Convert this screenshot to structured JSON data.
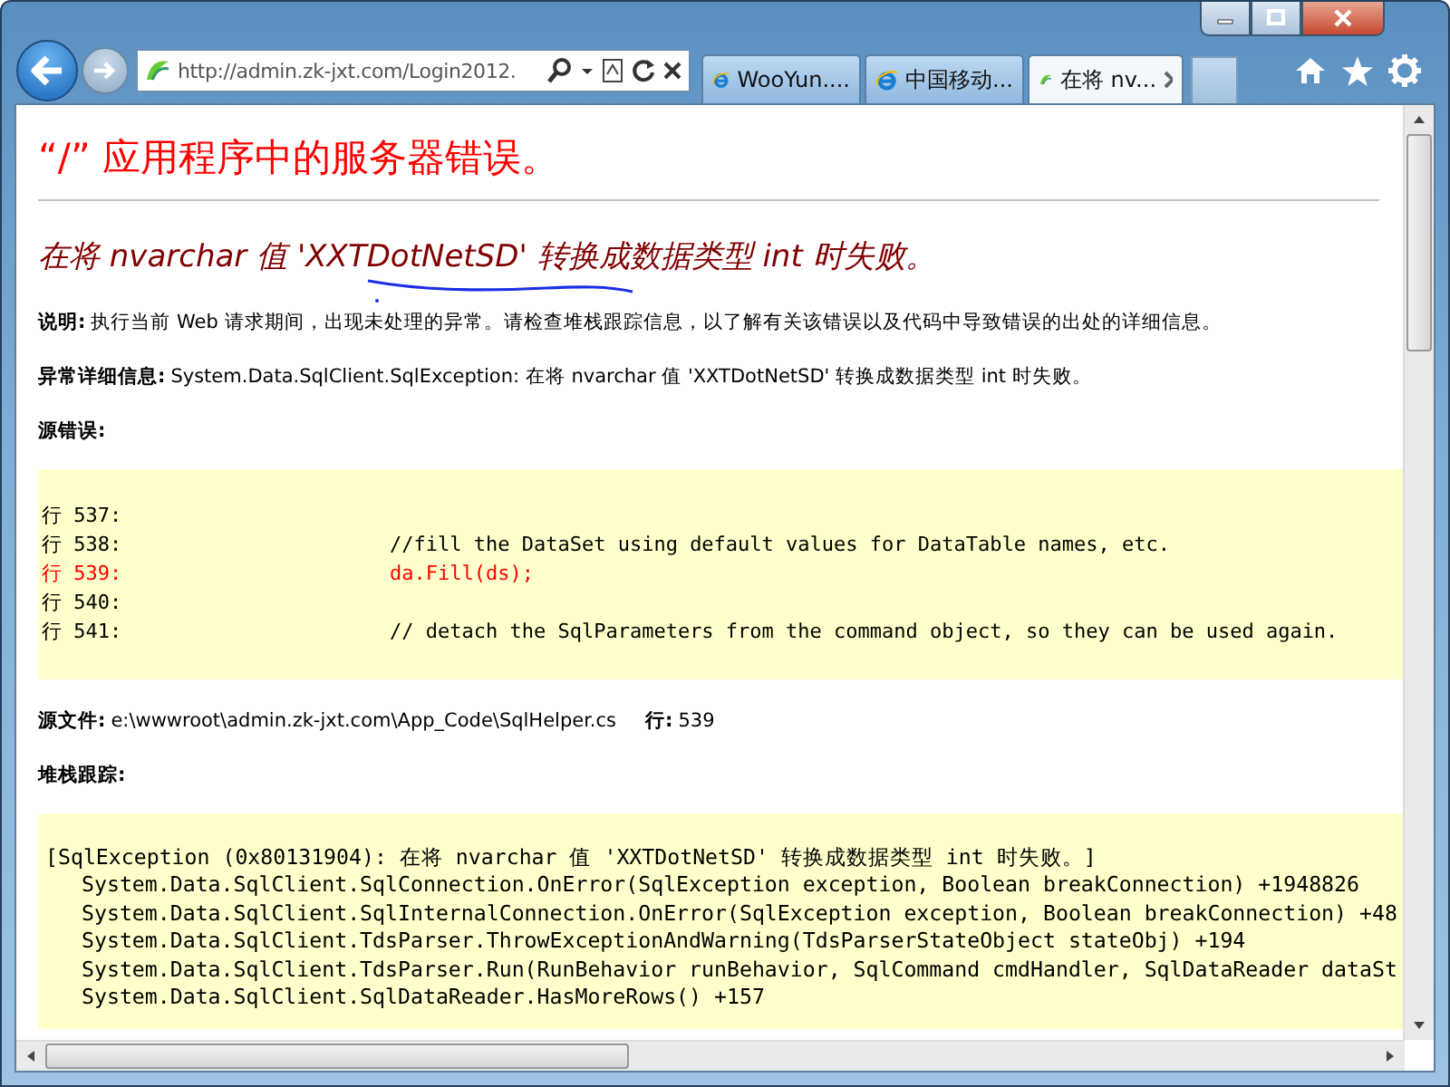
{
  "address_bar": {
    "url": "http://admin.zk-jxt.com/Login2012."
  },
  "tabs": [
    {
      "label": "WooYun....",
      "selected": false,
      "kind": "ie"
    },
    {
      "label": "中国移动...",
      "selected": false,
      "kind": "ie"
    },
    {
      "label": "在将 nv...",
      "selected": true,
      "kind": "site"
    }
  ],
  "page": {
    "title": "“/” 应用程序中的服务器错误。",
    "error_heading": {
      "before": "在将 nvarchar 值 ",
      "marked": "'XXTDotNetSD'",
      "after": " 转换成数据类型 int 时失败。"
    },
    "description": {
      "label": "说明:",
      "text": "执行当前 Web 请求期间，出现未处理的异常。请检查堆栈跟踪信息，以了解有关该错误以及代码中导致错误的出处的详细信息。"
    },
    "exception_details": {
      "label": "异常详细信息:",
      "text": "System.Data.SqlClient.SqlException: 在将 nvarchar 值 'XXTDotNetSD' 转换成数据类型 int 时失败。"
    },
    "source_error": {
      "label": "源错误:",
      "lines": [
        {
          "number": "行 537:",
          "highlighted": false
        },
        {
          "number": "行 538:",
          "code": "//fill the DataSet using default values for DataTable names, etc.",
          "highlighted": false
        },
        {
          "number": "行 539:",
          "code": "da.Fill(ds);",
          "highlighted": true
        },
        {
          "number": "行 540:",
          "highlighted": false
        },
        {
          "number": "行 541:",
          "code": "// detach the SqlParameters from the command object, so they can be used again.",
          "highlighted": false
        }
      ]
    },
    "source_file": {
      "label": "源文件:",
      "path": "e:\\wwwroot\\admin.zk-jxt.com\\App_Code\\SqlHelper.cs",
      "line_label": "行:",
      "line": "539"
    },
    "stack_trace": {
      "label": "堆栈跟踪:",
      "header": "[SqlException (0x80131904): 在将 nvarchar 值 'XXTDotNetSD' 转换成数据类型 int 时失败。]",
      "lines": [
        "System.Data.SqlClient.SqlConnection.OnError(SqlException exception, Boolean breakConnection) +1948826",
        "System.Data.SqlClient.SqlInternalConnection.OnError(SqlException exception, Boolean breakConnection) +48",
        "System.Data.SqlClient.TdsParser.ThrowExceptionAndWarning(TdsParserStateObject stateObj) +194",
        "System.Data.SqlClient.TdsParser.Run(RunBehavior runBehavior, SqlCommand cmdHandler, SqlDataReader dataSt",
        "System.Data.SqlClient.SqlDataReader.HasMoreRows() +157"
      ]
    }
  }
}
